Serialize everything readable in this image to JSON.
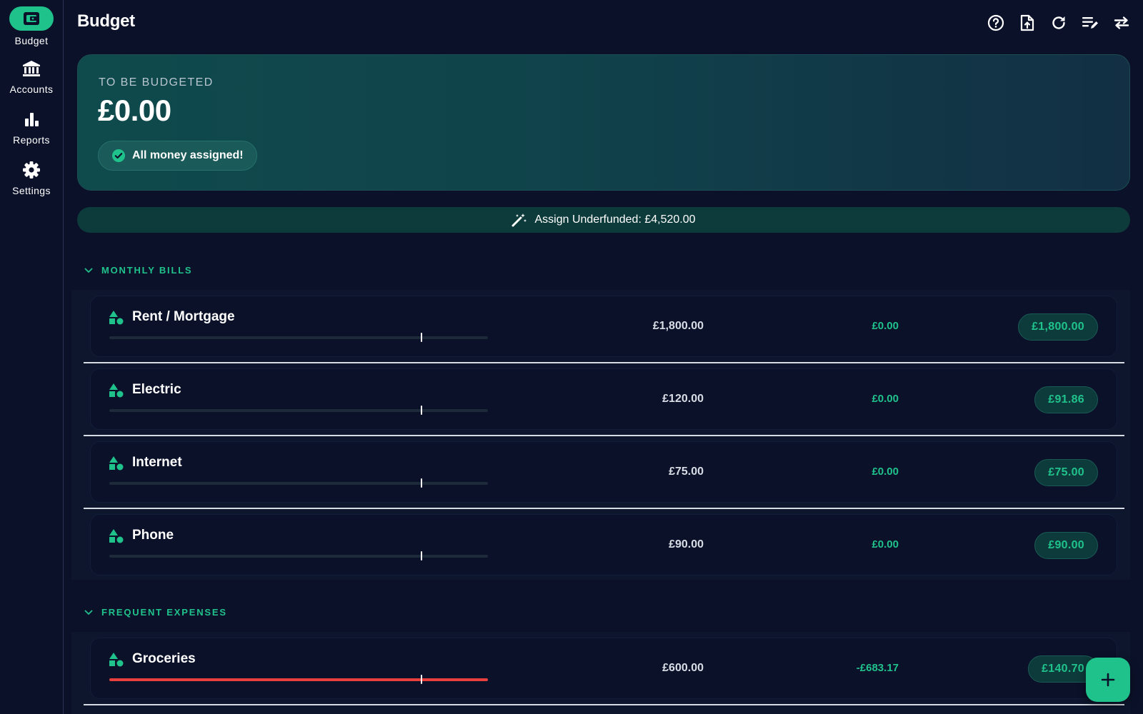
{
  "sidebar": {
    "items": [
      {
        "label": "Budget",
        "icon": "wallet-icon",
        "active": true
      },
      {
        "label": "Accounts",
        "icon": "bank-icon"
      },
      {
        "label": "Reports",
        "icon": "bar-chart-icon"
      },
      {
        "label": "Settings",
        "icon": "gear-icon"
      }
    ]
  },
  "header": {
    "title": "Budget",
    "toolbar_icons": [
      "help-icon",
      "file-upload-icon",
      "refresh-icon",
      "edit-list-icon",
      "swap-icon"
    ]
  },
  "summary": {
    "label": "TO BE BUDGETED",
    "amount": "£0.00",
    "status": "All money assigned!"
  },
  "assign_underfunded": {
    "label": "Assign Underfunded: £4,520.00"
  },
  "groups": [
    {
      "name": "MONTHLY BILLS",
      "categories": [
        {
          "name": "Rent / Mortgage",
          "budgeted": "£1,800.00",
          "activity": "£0.00",
          "available": "£1,800.00",
          "progress": 0
        },
        {
          "name": "Electric",
          "budgeted": "£120.00",
          "activity": "£0.00",
          "available": "£91.86",
          "progress": 0
        },
        {
          "name": "Internet",
          "budgeted": "£75.00",
          "activity": "£0.00",
          "available": "£75.00",
          "progress": 0
        },
        {
          "name": "Phone",
          "budgeted": "£90.00",
          "activity": "£0.00",
          "available": "£90.00",
          "progress": 0
        }
      ]
    },
    {
      "name": "FREQUENT EXPENSES",
      "categories": [
        {
          "name": "Groceries",
          "budgeted": "£600.00",
          "activity": "-£683.17",
          "available": "£140.70",
          "progress": 1
        }
      ]
    }
  ],
  "colors": {
    "background": "#0b1129",
    "accent": "#20c28c",
    "overspent": "#e8403d"
  }
}
